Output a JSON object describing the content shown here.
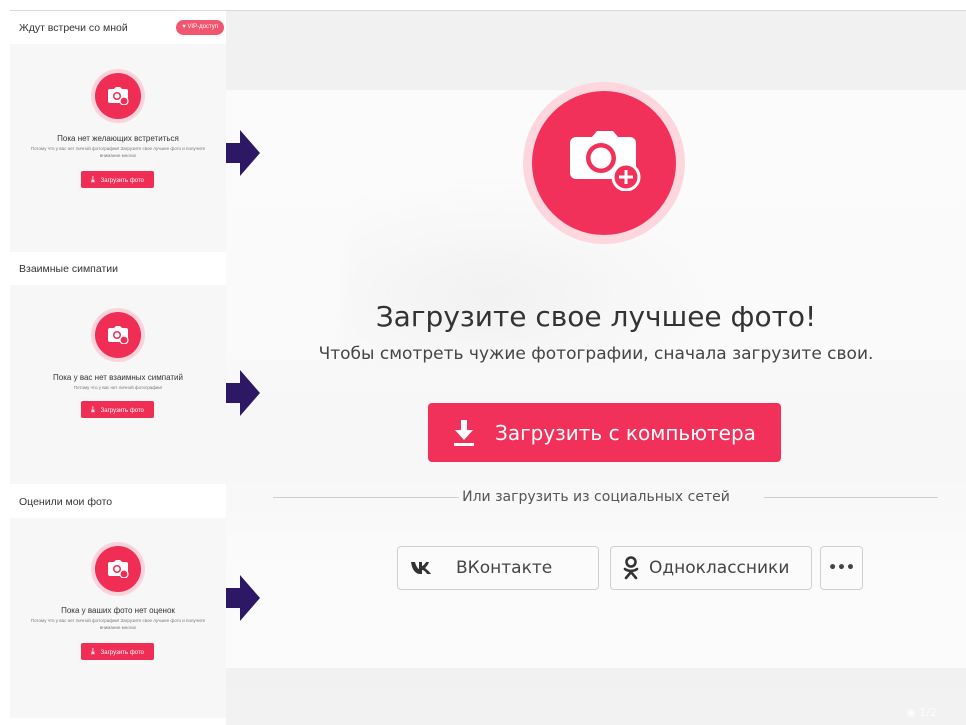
{
  "left_panels": [
    {
      "header": "Ждут встречи со мной",
      "badge": "♥ VIP-доступ",
      "title": "Пока нет желающих встретиться",
      "subtitle": "Потому что у вас нет личной фотографии! Загрузите свое лучшее фото и получите внимание многих",
      "button": "Загрузить фото"
    },
    {
      "header": "Взаимные симпатии",
      "title": "Пока у вас нет взаимных симпатий",
      "subtitle": "Потому что у вас нет личной фотографии!",
      "button": "Загрузить фото"
    },
    {
      "header": "Оценили мои фото",
      "title": "Пока у ваших фото нет оценок",
      "subtitle": "Потому что у вас нет личной фотографии! Загрузите свое лучшее фото и получите внимание многих",
      "button": "Загрузить фото"
    }
  ],
  "modal": {
    "title": "Загрузите свое лучшее фото!",
    "subtitle": "Чтобы смотреть чужие фотографии, сначала загрузите свои.",
    "upload_button": "Загрузить с компьютера",
    "social_divider": "Или загрузить из социальных сетей",
    "social": {
      "vk_label": "ВКонтакте",
      "ok_label": "Одноклассники",
      "more_label": "•••"
    }
  },
  "photo_counter": "1/2",
  "icons": {
    "camera": "camera-plus-icon",
    "download": "download-icon",
    "vk": "vk-icon",
    "ok": "odnoklassniki-icon",
    "arrow": "arrow-right-icon"
  },
  "colors": {
    "accent": "#f2315a",
    "accent_light": "#fdd6de",
    "arrow": "#2d1866"
  }
}
